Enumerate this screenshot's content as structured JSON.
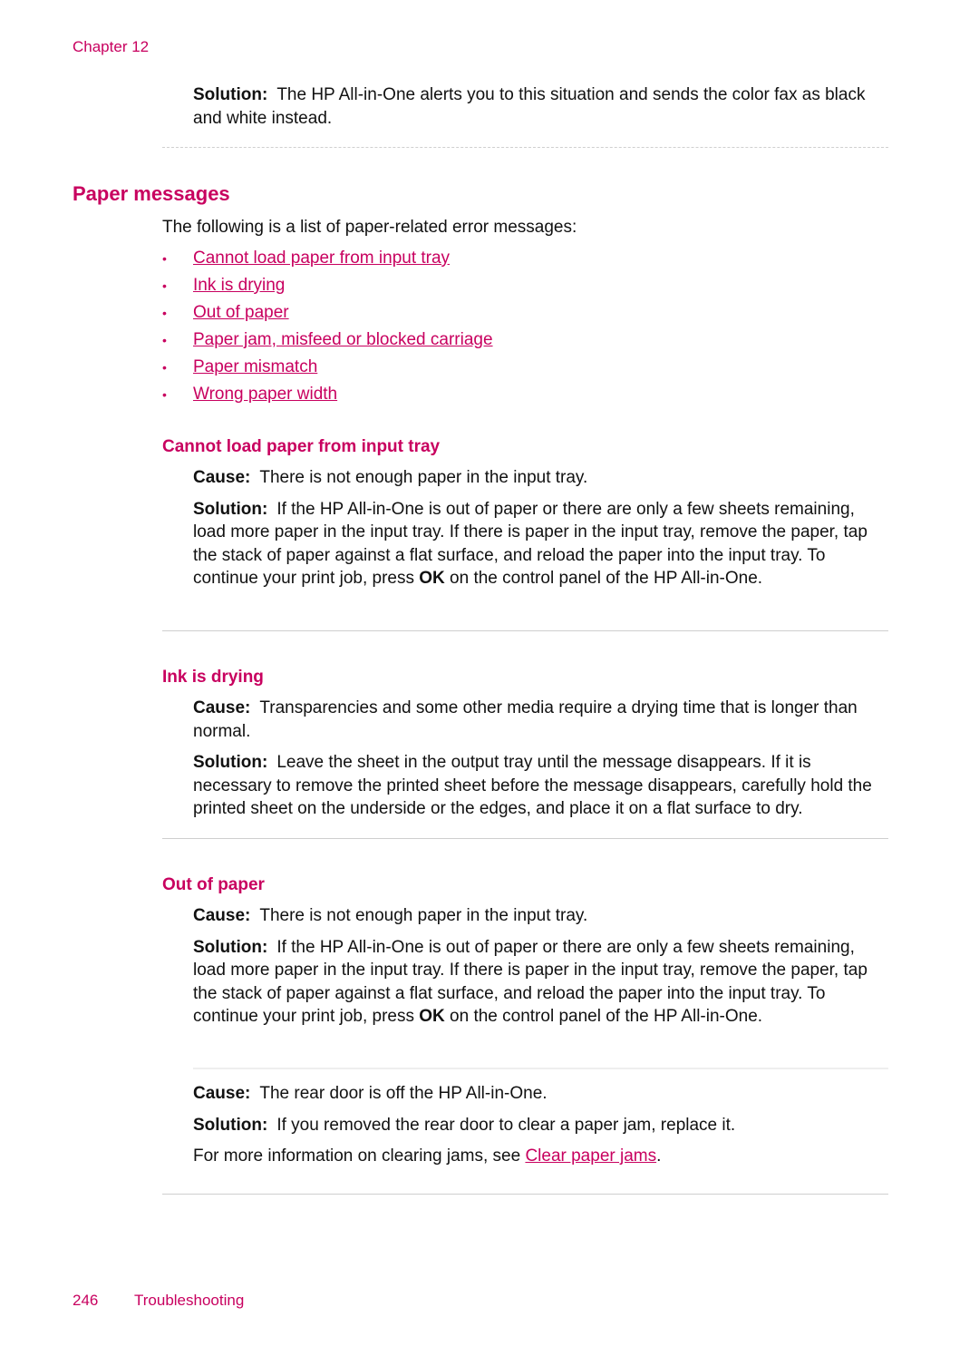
{
  "header": {
    "chapter": "Chapter 12"
  },
  "top_solution": {
    "label": "Solution:",
    "text": "The HP All-in-One alerts you to this situation and sends the color fax as black and white instead."
  },
  "section": {
    "title": "Paper messages",
    "intro": "The following is a list of paper-related error messages:",
    "links": [
      "Cannot load paper from input tray",
      "Ink is drying",
      "Out of paper",
      "Paper jam, misfeed or blocked carriage",
      "Paper mismatch",
      "Wrong paper width"
    ]
  },
  "topics": {
    "cannot_load": {
      "title": "Cannot load paper from input tray",
      "cause_label": "Cause:",
      "cause": "There is not enough paper in the input tray.",
      "solution_label": "Solution:",
      "solution_before": "If the HP All-in-One is out of paper or there are only a few sheets remaining, load more paper in the input tray. If there is paper in the input tray, remove the paper, tap the stack of paper against a flat surface, and reload the paper into the input tray. To continue your print job, press ",
      "solution_bold": "OK",
      "solution_after": " on the control panel of the HP All-in-One."
    },
    "ink_drying": {
      "title": "Ink is drying",
      "cause_label": "Cause:",
      "cause": "Transparencies and some other media require a drying time that is longer than normal.",
      "solution_label": "Solution:",
      "solution": "Leave the sheet in the output tray until the message disappears. If it is necessary to remove the printed sheet before the message disappears, carefully hold the printed sheet on the underside or the edges, and place it on a flat surface to dry."
    },
    "out_of_paper": {
      "title": "Out of paper",
      "cause_label": "Cause:",
      "cause": "There is not enough paper in the input tray.",
      "solution_label": "Solution:",
      "solution_before": "If the HP All-in-One is out of paper or there are only a few sheets remaining, load more paper in the input tray. If there is paper in the input tray, remove the paper, tap the stack of paper against a flat surface, and reload the paper into the input tray. To continue your print job, press ",
      "solution_bold": "OK",
      "solution_after": " on the control panel of the HP All-in-One.",
      "cause2_label": "Cause:",
      "cause2": "The rear door is off the HP All-in-One.",
      "solution2_label": "Solution:",
      "solution2": "If you removed the rear door to clear a paper jam, replace it.",
      "more_info": "For more information on clearing jams, see ",
      "more_info_link": "Clear paper jams",
      "more_info_end": "."
    }
  },
  "footer": {
    "page_number": "246",
    "section": "Troubleshooting"
  },
  "colors": {
    "accent": "#c8005f",
    "text": "#111111",
    "rule": "#cfcfcf"
  }
}
